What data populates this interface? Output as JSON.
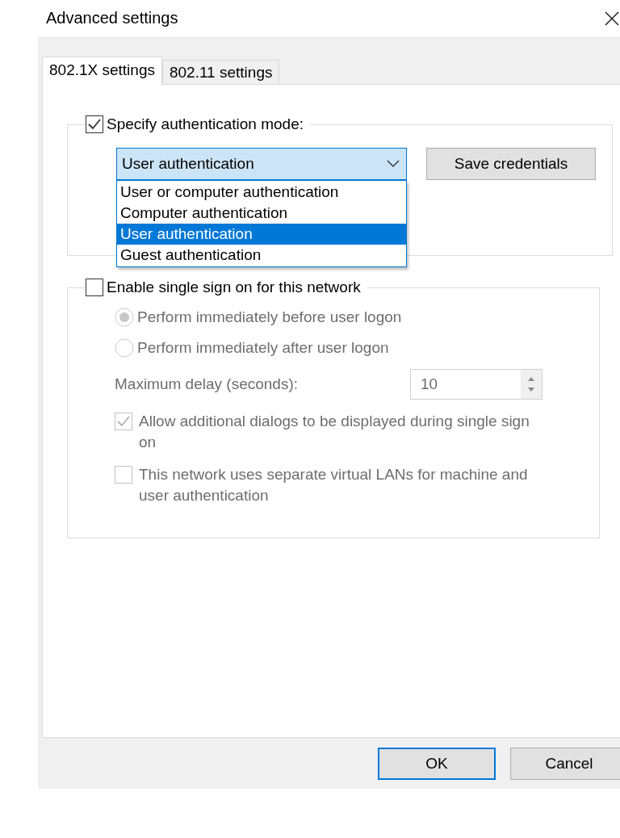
{
  "window": {
    "title": "Advanced settings"
  },
  "tabs": [
    {
      "label": "802.1X settings",
      "selected": true
    },
    {
      "label": "802.11 settings",
      "selected": false
    }
  ],
  "auth_group": {
    "checkbox": {
      "label": "Specify authentication mode:",
      "checked": true
    },
    "mode_dropdown": {
      "value": "User authentication",
      "expanded": true,
      "options": [
        {
          "label": "User or computer authentication",
          "selected": false
        },
        {
          "label": "Computer authentication",
          "selected": false
        },
        {
          "label": "User authentication",
          "selected": true
        },
        {
          "label": "Guest authentication",
          "selected": false
        }
      ]
    },
    "save_button": "Save credentials"
  },
  "sso_group": {
    "checkbox": {
      "label": "Enable single sign on for this network",
      "checked": false
    },
    "disabled": true,
    "radios": [
      {
        "label": "Perform immediately before user logon",
        "selected": true
      },
      {
        "label": "Perform immediately after user logon",
        "selected": false
      }
    ],
    "delay": {
      "label": "Maximum delay (seconds):",
      "value": "10"
    },
    "options": [
      {
        "label": "Allow additional dialogs to be displayed during single sign on",
        "checked": true
      },
      {
        "label": "This network uses separate virtual LANs for machine and user authentication",
        "checked": false
      }
    ]
  },
  "buttons": [
    {
      "label": "OK",
      "default": true
    },
    {
      "label": "Cancel",
      "default": false
    }
  ]
}
